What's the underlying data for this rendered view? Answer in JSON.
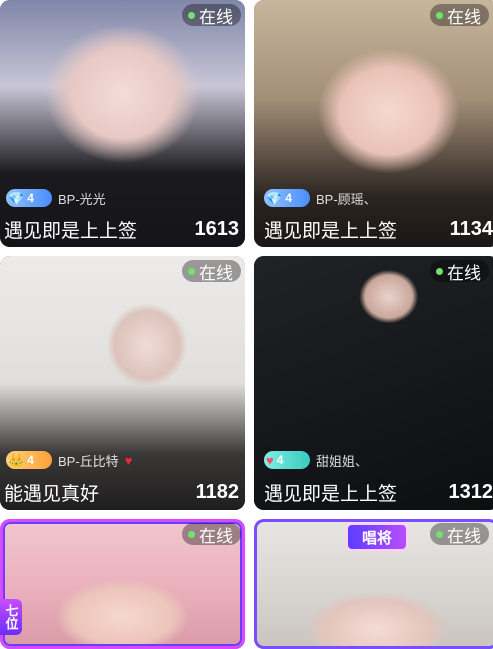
{
  "online_label": "在线",
  "cards": [
    {
      "subtitle": "BP-光光",
      "badge_level": "4",
      "badge_icon": "diamond-icon",
      "title": "遇见即是上上签",
      "count": "1613"
    },
    {
      "subtitle": "BP-顾瑶、",
      "badge_level": "4",
      "badge_icon": "diamond-icon",
      "title": "遇见即是上上签",
      "count": "1134"
    },
    {
      "subtitle": "BP-丘比特",
      "badge_level": "4",
      "badge_icon": "crown-icon",
      "title": "能遇见真好",
      "count": "1182"
    },
    {
      "subtitle": "甜姐姐、",
      "badge_level": "4",
      "badge_icon": "heart-icon",
      "title": "遇见即是上上签",
      "count": "1312"
    },
    {
      "side_tag": "七位"
    },
    {
      "tag": "唱将"
    }
  ]
}
